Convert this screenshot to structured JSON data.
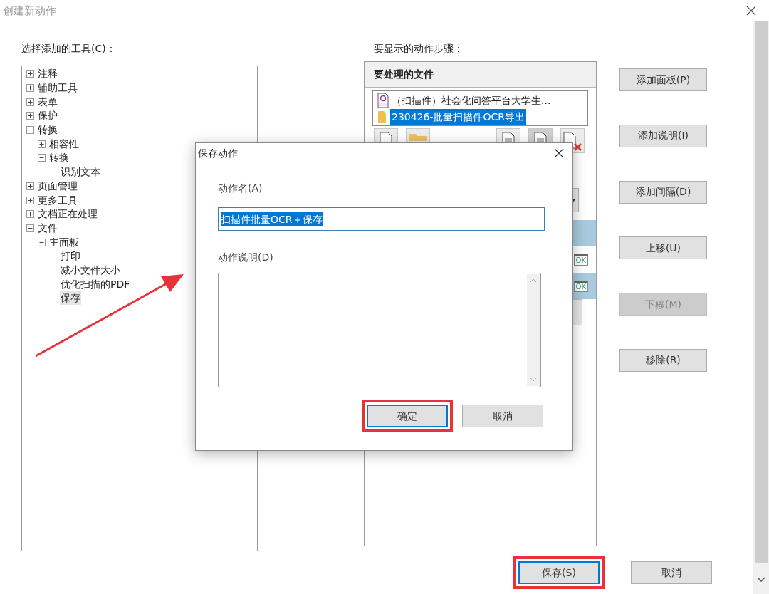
{
  "window": {
    "title": "创建新动作"
  },
  "tools": {
    "label": "选择添加的工具(C)：",
    "tree": [
      {
        "label": "注释",
        "expanded": false,
        "selected": false
      },
      {
        "label": "辅助工具",
        "expanded": false,
        "selected": false
      },
      {
        "label": "表单",
        "expanded": false,
        "selected": false
      },
      {
        "label": "保护",
        "expanded": false,
        "selected": false
      },
      {
        "label": "转换",
        "expanded": true,
        "selected": false,
        "children": [
          {
            "label": "相容性",
            "expanded": false,
            "selected": false
          },
          {
            "label": "转换",
            "expanded": true,
            "selected": false,
            "children": [
              {
                "label": "识别文本",
                "selected": false
              }
            ]
          }
        ]
      },
      {
        "label": "页面管理",
        "expanded": false,
        "selected": false
      },
      {
        "label": "更多工具",
        "expanded": false,
        "selected": false
      },
      {
        "label": "文档正在处理",
        "expanded": false,
        "selected": false
      },
      {
        "label": "文件",
        "expanded": true,
        "selected": false,
        "children": [
          {
            "label": "主面板",
            "expanded": true,
            "selected": false,
            "children": [
              {
                "label": "打印",
                "selected": false
              },
              {
                "label": "减小文件大小",
                "selected": false
              },
              {
                "label": "优化扫描的PDF",
                "selected": false
              },
              {
                "label": "保存",
                "selected": true
              }
            ]
          }
        ]
      }
    ]
  },
  "steps_panel": {
    "label": "要显示的动作步骤：",
    "header": "要处理的文件",
    "files": [
      {
        "kind": "pdf",
        "name": "（扫描件）社会化问答平台大学生...",
        "selected": false
      },
      {
        "kind": "folder",
        "name": "230426-批量扫描件OCR导出",
        "selected": true
      }
    ],
    "toolbar": [
      {
        "kind": "add-file",
        "disabled": false
      },
      {
        "kind": "add-folder",
        "disabled": false
      },
      {
        "kind": "document",
        "disabled": false
      },
      {
        "kind": "document",
        "disabled": true
      },
      {
        "kind": "remove",
        "disabled": false
      }
    ],
    "steps": [
      {
        "selected": true
      },
      {
        "badge": "OK",
        "selected": false
      },
      {
        "badge": "OK",
        "selected": true
      }
    ]
  },
  "side_buttons": [
    {
      "label": "添加面板(P)",
      "disabled": false
    },
    {
      "label": "添加说明(I)",
      "disabled": false
    },
    {
      "label": "添加间隔(D)",
      "disabled": false
    },
    {
      "label": "上移(U)",
      "disabled": false
    },
    {
      "label": "下移(M)",
      "disabled": true
    },
    {
      "label": "移除(R)",
      "disabled": false
    }
  ],
  "footer_buttons": [
    {
      "label": "保存(S)",
      "default": true,
      "highlighted": true
    },
    {
      "label": "取消",
      "default": false,
      "highlighted": false
    }
  ],
  "dialog": {
    "title": "保存动作",
    "name_label": "动作名(A)",
    "name_value": "扫描件批量OCR＋保存",
    "description_label": "动作说明(D)",
    "buttons": [
      {
        "label": "确定",
        "default": true,
        "highlighted": true
      },
      {
        "label": "取消",
        "default": false,
        "highlighted": false
      }
    ]
  }
}
